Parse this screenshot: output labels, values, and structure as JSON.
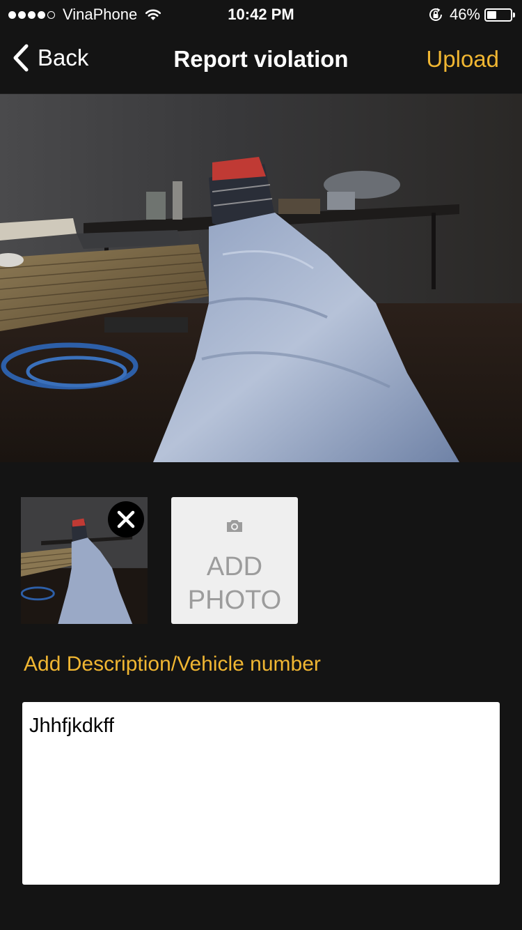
{
  "status_bar": {
    "carrier": "VinaPhone",
    "signal_bars_filled": 4,
    "signal_bars_total": 5,
    "time": "10:42 PM",
    "battery_percent_label": "46%",
    "battery_level": 0.46,
    "icons": [
      "signal-dots-icon",
      "wifi-icon",
      "lock-rotation-icon",
      "battery-icon"
    ]
  },
  "nav": {
    "back_label": "Back",
    "title": "Report violation",
    "upload_label": "Upload",
    "icons": [
      "back-chevron-icon"
    ]
  },
  "photos": {
    "remove_icon": "close-icon",
    "add_photo_icon": "camera-icon",
    "add_photo_label": "ADD\nPHOTO"
  },
  "description": {
    "label": "Add Description/Vehicle number",
    "value": "Jhhfjkdkff"
  },
  "colors": {
    "accent": "#f0b632",
    "background": "#141414",
    "add_photo_bg": "#efefef",
    "add_photo_text": "#9c9c9c"
  }
}
